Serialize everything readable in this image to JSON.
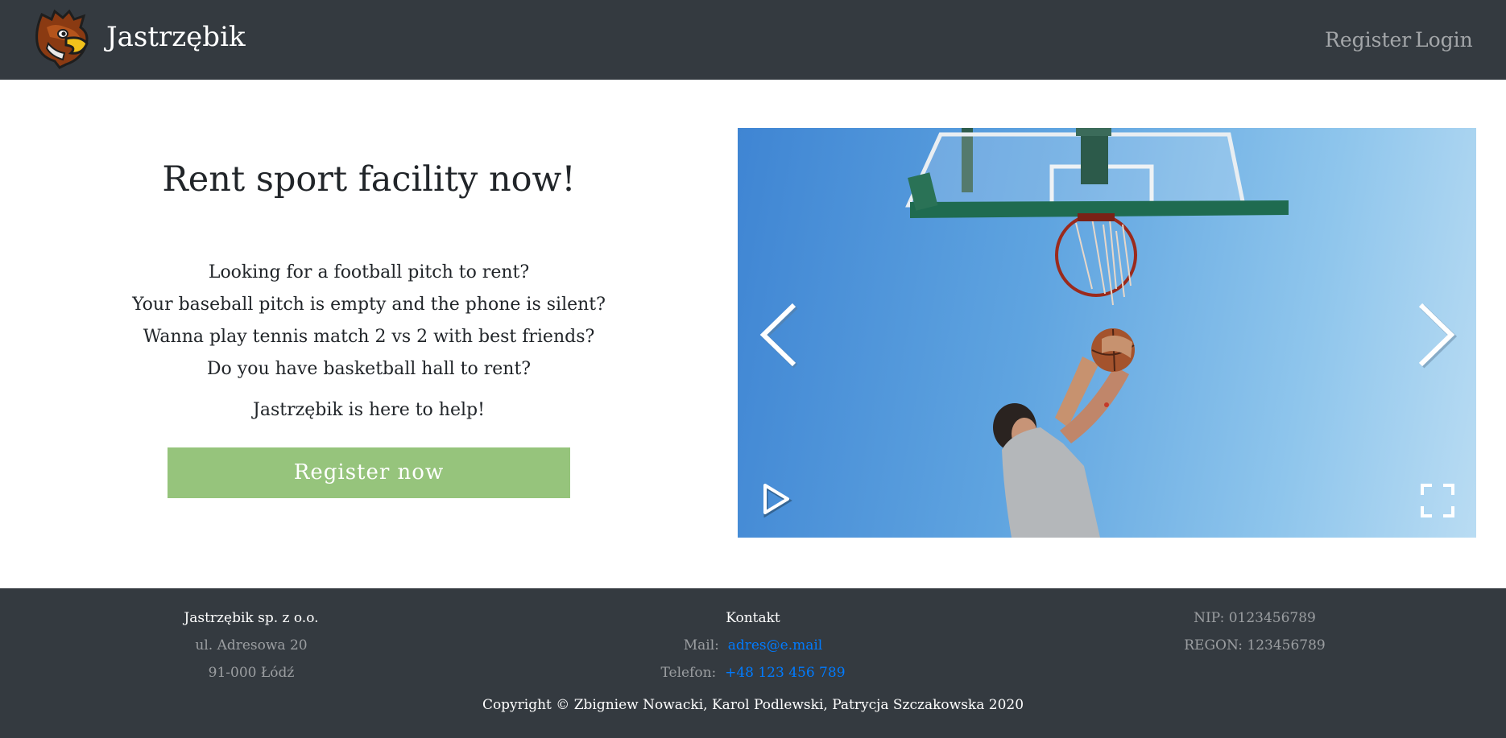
{
  "navbar": {
    "brand": "Jastrzębik",
    "links": {
      "register": "Register",
      "login": "Login"
    }
  },
  "hero": {
    "title": "Rent sport facility now!",
    "lines": [
      "Looking for a football pitch to rent?",
      "Your baseball pitch is empty and the phone is silent?",
      "Wanna play tennis match 2 vs 2 with best friends?",
      "Do you have basketball hall to rent?"
    ],
    "help": "Jastrzębik is here to help!",
    "cta": "Register now"
  },
  "carousel": {
    "icons": [
      "chevron-left-icon",
      "chevron-right-icon",
      "play-icon",
      "fullscreen-icon"
    ]
  },
  "footer": {
    "company": {
      "name": "Jastrzębik sp. z o.o.",
      "street": "ul. Adresowa 20",
      "city": "91-000 Łódź"
    },
    "contact": {
      "heading": "Kontakt",
      "mail_label": "Mail:",
      "mail_value": "adres@e.mail",
      "phone_label": "Telefon:",
      "phone_value": "+48 123 456 789"
    },
    "ids": {
      "nip": "NIP: 0123456789",
      "regon": "REGON: 123456789"
    },
    "copyright": "Copyright © Zbigniew Nowacki, Karol Podlewski, Patrycja Szczakowska 2020"
  },
  "colors": {
    "navbar_bg": "#343a40",
    "cta_green": "#96c47c",
    "link_blue": "#007bff"
  }
}
